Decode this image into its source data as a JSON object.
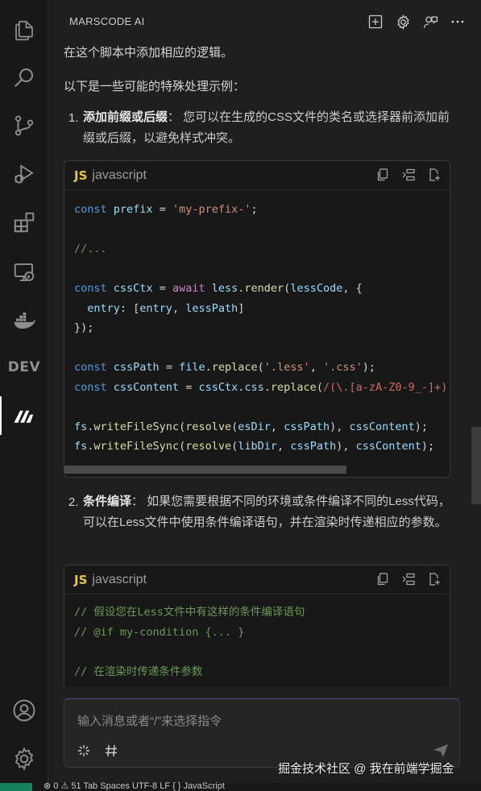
{
  "panel": {
    "title": "MARSCODE AI"
  },
  "messages": {
    "intro_line": "在这个脚本中添加相应的逻辑。",
    "examples_line": "以下是一些可能的特殊处理示例：",
    "item1": {
      "number": "1.",
      "title": "添加前缀或后缀",
      "text": "： 您可以在生成的CSS文件的类名或选择器前添加前缀或后缀，以避免样式冲突。"
    },
    "item2": {
      "number": "2.",
      "title": "条件编译",
      "text": "： 如果您需要根据不同的环境或条件编译不同的Less代码，可以在Less文件中使用条件编译语句，并在渲染时传递相应的参数。"
    }
  },
  "code_blocks": [
    {
      "badge": "JS",
      "language": "javascript",
      "lines": [
        "const prefix = 'my-prefix-';",
        "",
        "//...",
        "",
        "const cssCtx = await less.render(lessCode, {",
        "  entry: [entry, lessPath]",
        "});",
        "",
        "const cssPath = file.replace('.less', '.css');",
        "const cssContent = cssCtx.css.replace(/(\\.[a-zA-Z0-9_-]+)",
        "",
        "fs.writeFileSync(resolve(esDir, cssPath), cssContent);",
        "fs.writeFileSync(resolve(libDir, cssPath), cssContent);"
      ]
    },
    {
      "badge": "JS",
      "language": "javascript",
      "lines": [
        "// 假设您在Less文件中有这样的条件编译语句",
        "// @if my-condition {... }",
        "",
        "// 在渲染时传递条件参数"
      ]
    }
  ],
  "input": {
    "placeholder": "输入消息或者“/”来选择指令"
  },
  "watermark": "掘金技术社区 @ 我在前端学掘金",
  "status_bar": {
    "text": "⊗ 0 ⚠ 51   Tab  Spaces  UTF-8  LF  { }  JavaScript"
  },
  "icons": [
    "files-icon",
    "search-icon",
    "source-control-icon",
    "run-debug-icon",
    "extensions-icon",
    "remote-explorer-icon",
    "docker-icon",
    "dev-icon",
    "marscode-icon",
    "account-icon",
    "manage-gear-icon",
    "new-chat-icon",
    "settings-icon",
    "feedback-icon",
    "more-icon",
    "copy-icon",
    "insert-icon",
    "new-file-icon",
    "sparkle-icon",
    "hash-icon",
    "send-icon"
  ],
  "colors": {
    "background": "#1f1f1f",
    "activity_bar": "#181818",
    "keyword": "#569cd6",
    "string": "#ce9178",
    "comment": "#6a9955",
    "function": "#dcdcaa",
    "variable": "#9cdcfe",
    "js_badge": "#e7c547",
    "status_remote": "#16825d"
  }
}
